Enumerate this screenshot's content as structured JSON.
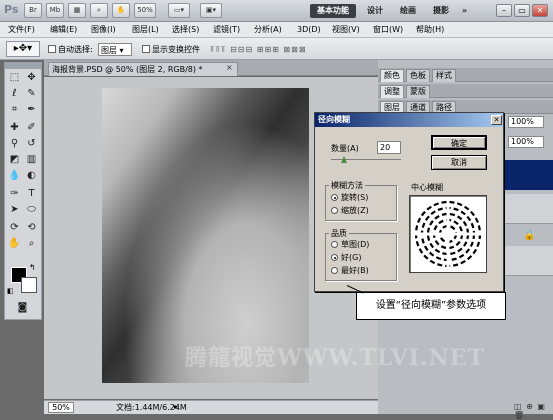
{
  "appbar": {
    "logo": "Ps",
    "br": "Br",
    "mb": "Mb",
    "zoom": "50%",
    "workspaces": [
      "基本功能",
      "设计",
      "绘画",
      "摄影"
    ],
    "more": "»"
  },
  "menus": [
    "文件(F)",
    "编辑(E)",
    "图像(I)",
    "图层(L)",
    "选择(S)",
    "滤镜(T)",
    "分析(A)",
    "3D(D)",
    "视图(V)",
    "窗口(W)",
    "帮助(H)"
  ],
  "options": {
    "auto_select": "自动选择:",
    "layer": "图层",
    "show_transform": "显示变换控件"
  },
  "doc": {
    "tab": "海报背景.PSD @ 50% (图层 2, RGB/8) *",
    "zoom": "50%",
    "status": "文档:1.44M/6.24M"
  },
  "panels": {
    "group1": [
      "颜色",
      "色板",
      "样式"
    ],
    "group2": [
      "调整",
      "蒙版"
    ],
    "group3": [
      "图层",
      "通道",
      "路径"
    ],
    "opacity": "100%",
    "fill": "100%"
  },
  "dialog": {
    "title": "径向模糊",
    "amount_label": "数量(A)",
    "amount": "20",
    "ok": "确定",
    "cancel": "取消",
    "method_title": "模糊方法",
    "methods": [
      "旋转(S)",
      "缩放(Z)"
    ],
    "quality_title": "品质",
    "qualities": [
      "草图(D)",
      "好(G)",
      "最好(B)"
    ],
    "center_label": "中心模糊"
  },
  "callout": "设置“径向模糊”参数选项",
  "watermark": "腾龍视觉WWW.TLVI.NET",
  "colors": {
    "title_bar": "#0a246a",
    "dialog_bg": "#d4d0c8"
  }
}
